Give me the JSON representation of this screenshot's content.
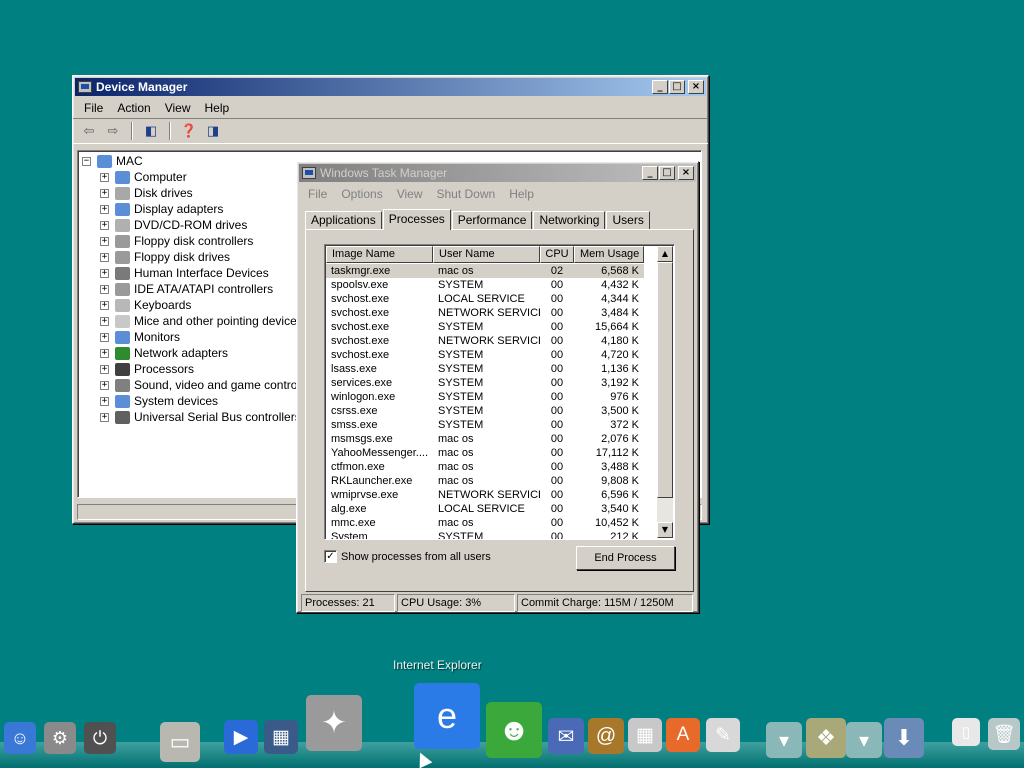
{
  "device_manager": {
    "title": "Device Manager",
    "menu": [
      "File",
      "Action",
      "View",
      "Help"
    ],
    "tree_root": "MAC",
    "tree_items": [
      {
        "label": "Computer",
        "icon": "computer-icon",
        "color": "#5a8fd8"
      },
      {
        "label": "Disk drives",
        "icon": "disk-drive-icon",
        "color": "#a8a8a8"
      },
      {
        "label": "Display adapters",
        "icon": "display-adapter-icon",
        "color": "#5a8fd8"
      },
      {
        "label": "DVD/CD-ROM drives",
        "icon": "cdrom-icon",
        "color": "#b0b0b0"
      },
      {
        "label": "Floppy disk controllers",
        "icon": "controller-icon",
        "color": "#9a9a9a"
      },
      {
        "label": "Floppy disk drives",
        "icon": "floppy-icon",
        "color": "#9a9a9a"
      },
      {
        "label": "Human Interface Devices",
        "icon": "hid-icon",
        "color": "#7a7a7a"
      },
      {
        "label": "IDE ATA/ATAPI controllers",
        "icon": "ide-controller-icon",
        "color": "#9a9a9a"
      },
      {
        "label": "Keyboards",
        "icon": "keyboard-icon",
        "color": "#b8b8b8"
      },
      {
        "label": "Mice and other pointing devices",
        "icon": "mouse-icon",
        "color": "#c8c8c8"
      },
      {
        "label": "Monitors",
        "icon": "monitor-icon",
        "color": "#5a8fd8"
      },
      {
        "label": "Network adapters",
        "icon": "network-adapter-icon",
        "color": "#2e8b2e"
      },
      {
        "label": "Processors",
        "icon": "processor-icon",
        "color": "#404040"
      },
      {
        "label": "Sound, video and game controller",
        "icon": "sound-icon",
        "color": "#808080"
      },
      {
        "label": "System devices",
        "icon": "system-device-icon",
        "color": "#5a8fd8"
      },
      {
        "label": "Universal Serial Bus controllers",
        "icon": "usb-icon",
        "color": "#606060"
      }
    ]
  },
  "task_manager": {
    "title": "Windows Task Manager",
    "menu": [
      "File",
      "Options",
      "View",
      "Shut Down",
      "Help"
    ],
    "tabs": [
      "Applications",
      "Processes",
      "Performance",
      "Networking",
      "Users"
    ],
    "selected_tab": "Processes",
    "columns": [
      "Image Name",
      "User Name",
      "CPU",
      "Mem Usage"
    ],
    "processes": [
      [
        "taskmgr.exe",
        "mac os",
        "02",
        "6,568 K"
      ],
      [
        "spoolsv.exe",
        "SYSTEM",
        "00",
        "4,432 K"
      ],
      [
        "svchost.exe",
        "LOCAL SERVICE",
        "00",
        "4,344 K"
      ],
      [
        "svchost.exe",
        "NETWORK SERVICE",
        "00",
        "3,484 K"
      ],
      [
        "svchost.exe",
        "SYSTEM",
        "00",
        "15,664 K"
      ],
      [
        "svchost.exe",
        "NETWORK SERVICE",
        "00",
        "4,180 K"
      ],
      [
        "svchost.exe",
        "SYSTEM",
        "00",
        "4,720 K"
      ],
      [
        "lsass.exe",
        "SYSTEM",
        "00",
        "1,136 K"
      ],
      [
        "services.exe",
        "SYSTEM",
        "00",
        "3,192 K"
      ],
      [
        "winlogon.exe",
        "SYSTEM",
        "00",
        "976 K"
      ],
      [
        "csrss.exe",
        "SYSTEM",
        "00",
        "3,500 K"
      ],
      [
        "smss.exe",
        "SYSTEM",
        "00",
        "372 K"
      ],
      [
        "msmsgs.exe",
        "mac os",
        "00",
        "2,076 K"
      ],
      [
        "YahooMessenger....",
        "mac os",
        "00",
        "17,112 K"
      ],
      [
        "ctfmon.exe",
        "mac os",
        "00",
        "3,488 K"
      ],
      [
        "RKLauncher.exe",
        "mac os",
        "00",
        "9,808 K"
      ],
      [
        "wmiprvse.exe",
        "NETWORK SERVICE",
        "00",
        "6,596 K"
      ],
      [
        "alg.exe",
        "LOCAL SERVICE",
        "00",
        "3,540 K"
      ],
      [
        "mmc.exe",
        "mac os",
        "00",
        "10,452 K"
      ],
      [
        "System",
        "SYSTEM",
        "00",
        "212 K"
      ]
    ],
    "show_all_label": "Show processes from all users",
    "show_all_checked": true,
    "end_process_label": "End Process",
    "status": {
      "processes": "Processes: 21",
      "cpu": "CPU Usage: 3%",
      "commit": "Commit Charge: 115M / 1250M"
    }
  },
  "dock": {
    "hover_label": "Internet Explorer",
    "items": [
      {
        "name": "finder-icon",
        "glyph": "☺",
        "color": "#3a78d8"
      },
      {
        "name": "system-preferences-icon",
        "glyph": "⚙",
        "color": "#8a8a8a"
      },
      {
        "name": "power-icon",
        "glyph": "⏻",
        "color": "#505050"
      },
      {
        "name": "drive-icon",
        "glyph": "▭",
        "color": "#b8b8b0"
      },
      {
        "name": "media-player-icon",
        "glyph": "▶",
        "color": "#2a6ad8"
      },
      {
        "name": "movie-icon",
        "glyph": "▦",
        "color": "#3a5a8a"
      },
      {
        "name": "tools-icon",
        "glyph": "✦",
        "color": "#9a9a9a"
      },
      {
        "name": "internet-explorer-icon",
        "glyph": "e",
        "color": "#2a7ae8"
      },
      {
        "name": "messenger-icon",
        "glyph": "☻",
        "color": "#3aa83a"
      },
      {
        "name": "mail-icon",
        "glyph": "✉",
        "color": "#4a6ab8"
      },
      {
        "name": "address-book-icon",
        "glyph": "@",
        "color": "#a8782a"
      },
      {
        "name": "calculator-icon",
        "glyph": "▦",
        "color": "#c8c8c8"
      },
      {
        "name": "app-store-icon",
        "glyph": "A",
        "color": "#e86a2a"
      },
      {
        "name": "textedit-icon",
        "glyph": "✎",
        "color": "#d8d8d8"
      },
      {
        "name": "downloads-stack-icon",
        "glyph": "▾",
        "color": "#8ab8b8"
      },
      {
        "name": "applications-stack-icon",
        "glyph": "❖",
        "color": "#a8a878"
      },
      {
        "name": "documents-stack-icon",
        "glyph": "▾",
        "color": "#8ab8b8"
      },
      {
        "name": "install-icon",
        "glyph": "⬇",
        "color": "#6a8ab8"
      },
      {
        "name": "preview-icon",
        "glyph": "▯",
        "color": "#e8e8e8"
      },
      {
        "name": "trash-icon",
        "glyph": "🗑",
        "color": "#b8c8c8"
      }
    ]
  }
}
